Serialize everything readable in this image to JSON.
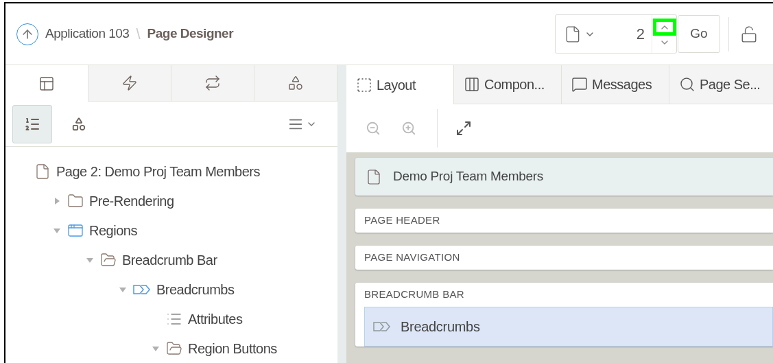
{
  "header": {
    "app_link": "Application 103",
    "separator": "\\",
    "title": "Page Designer",
    "page_number": "2",
    "go_button": "Go"
  },
  "spinner": {
    "up_highlighted": true
  },
  "left_tabs": [
    {
      "selected": true
    },
    {
      "selected": false
    },
    {
      "selected": false
    },
    {
      "selected": false
    }
  ],
  "left_toolbar": [
    {
      "selected": true
    },
    {
      "selected": false
    }
  ],
  "tree": [
    {
      "label": "Page 2: Demo Proj Team Members",
      "kind": "page",
      "children": [
        {
          "label": "Pre-Rendering",
          "kind": "folder",
          "expanded": false
        },
        {
          "label": "Regions",
          "kind": "region",
          "expanded": true,
          "children": [
            {
              "label": "Breadcrumb Bar",
              "kind": "folder-open",
              "expanded": true,
              "children": [
                {
                  "label": "Breadcrumbs",
                  "kind": "breadcrumb",
                  "expanded": true,
                  "children": [
                    {
                      "label": "Attributes",
                      "kind": "list"
                    },
                    {
                      "label": "Region Buttons",
                      "kind": "folder-open",
                      "expanded": true
                    }
                  ]
                }
              ]
            }
          ]
        }
      ]
    }
  ],
  "right_tabs": [
    {
      "label": "Layout",
      "selected": true
    },
    {
      "label": "Compon...",
      "selected": false
    },
    {
      "label": "Messages",
      "selected": false
    },
    {
      "label": "Page Se...",
      "selected": false
    }
  ],
  "canvas": {
    "page_title": "Demo Proj Team Members",
    "sections": [
      {
        "label": "PAGE HEADER"
      },
      {
        "label": "PAGE NAVIGATION"
      },
      {
        "label": "BREADCRUMB BAR",
        "children": [
          {
            "label": "Breadcrumbs",
            "selected": true
          }
        ]
      }
    ]
  }
}
